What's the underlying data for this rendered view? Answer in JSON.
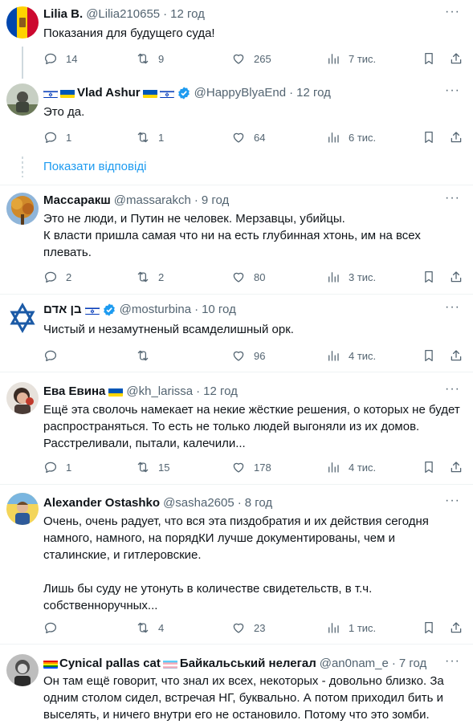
{
  "show_replies_label": "Показати відповіді",
  "colors": {
    "link": "#1d9bf0",
    "verified": "#1d9bf0",
    "secondary": "#536471"
  },
  "tweets": [
    {
      "name": "Lilia B.",
      "handle": "@Lilia210655",
      "time": "12 год",
      "lines": [
        "Показания для будущего суда!"
      ],
      "reply": "14",
      "retweet": "9",
      "like": "265",
      "views": "7 тис."
    },
    {
      "name": "Vlad Ashur",
      "handle": "@HappyBlyaEnd",
      "time": "12 год",
      "lines": [
        "Это да."
      ],
      "reply": "1",
      "retweet": "1",
      "like": "64",
      "views": "6 тис."
    },
    {
      "name": "Массаракш",
      "handle": "@massarakch",
      "time": "9 год",
      "lines": [
        "Это не люди, и Путин не человек. Мерзавцы, убийцы.",
        "К власти пришла самая что ни на есть глубинная хтонь, им на всех",
        "плевать."
      ],
      "reply": "2",
      "retweet": "2",
      "like": "80",
      "views": "3 тис."
    },
    {
      "name": "בן אדם",
      "handle": "@mosturbina",
      "time": "10 год",
      "lines": [
        "Чистый и незамутненый всамделишный орк."
      ],
      "reply": "",
      "retweet": "",
      "like": "96",
      "views": "4 тис."
    },
    {
      "name": "Ева Евина",
      "handle": "@kh_larissa",
      "time": "12 год",
      "lines": [
        "Ещё эта сволочь намекает на некие жёсткие решения, о которых не будет",
        "распространяться. То есть не только людей выгоняли из их домов.",
        "Расстреливали, пытали, калечили..."
      ],
      "reply": "1",
      "retweet": "15",
      "like": "178",
      "views": "4 тис."
    },
    {
      "name": "Alexander Ostashko",
      "handle": "@sasha2605",
      "time": "8 год",
      "lines": [
        "Очень, очень радует, что вся эта пиздобратия и их действия сегодня",
        "намного, намного, на порядКИ лучше документированы, чем и",
        "сталинские, и гитлеровские.",
        "",
        "Лишь бы суду не утонуть в количестве свидетельств, в т.ч.",
        "собственноручных..."
      ],
      "reply": "",
      "retweet": "4",
      "like": "23",
      "views": "1 тис."
    },
    {
      "name": "Cynical pallas cat",
      "name2": "Байкальський нелегал",
      "handle": "@an0nam_e",
      "time": "7 год",
      "lines": [
        "Он там ещё говорит, что знал их всех,  некоторых - довольно близко. За",
        "одним столом сидел, встречая НГ, буквально. А потом приходил бить и",
        "выселять, и ничего внутри его не остановило. Потому что это зомби."
      ],
      "reply": "",
      "retweet": "",
      "like": "",
      "views": ""
    }
  ]
}
